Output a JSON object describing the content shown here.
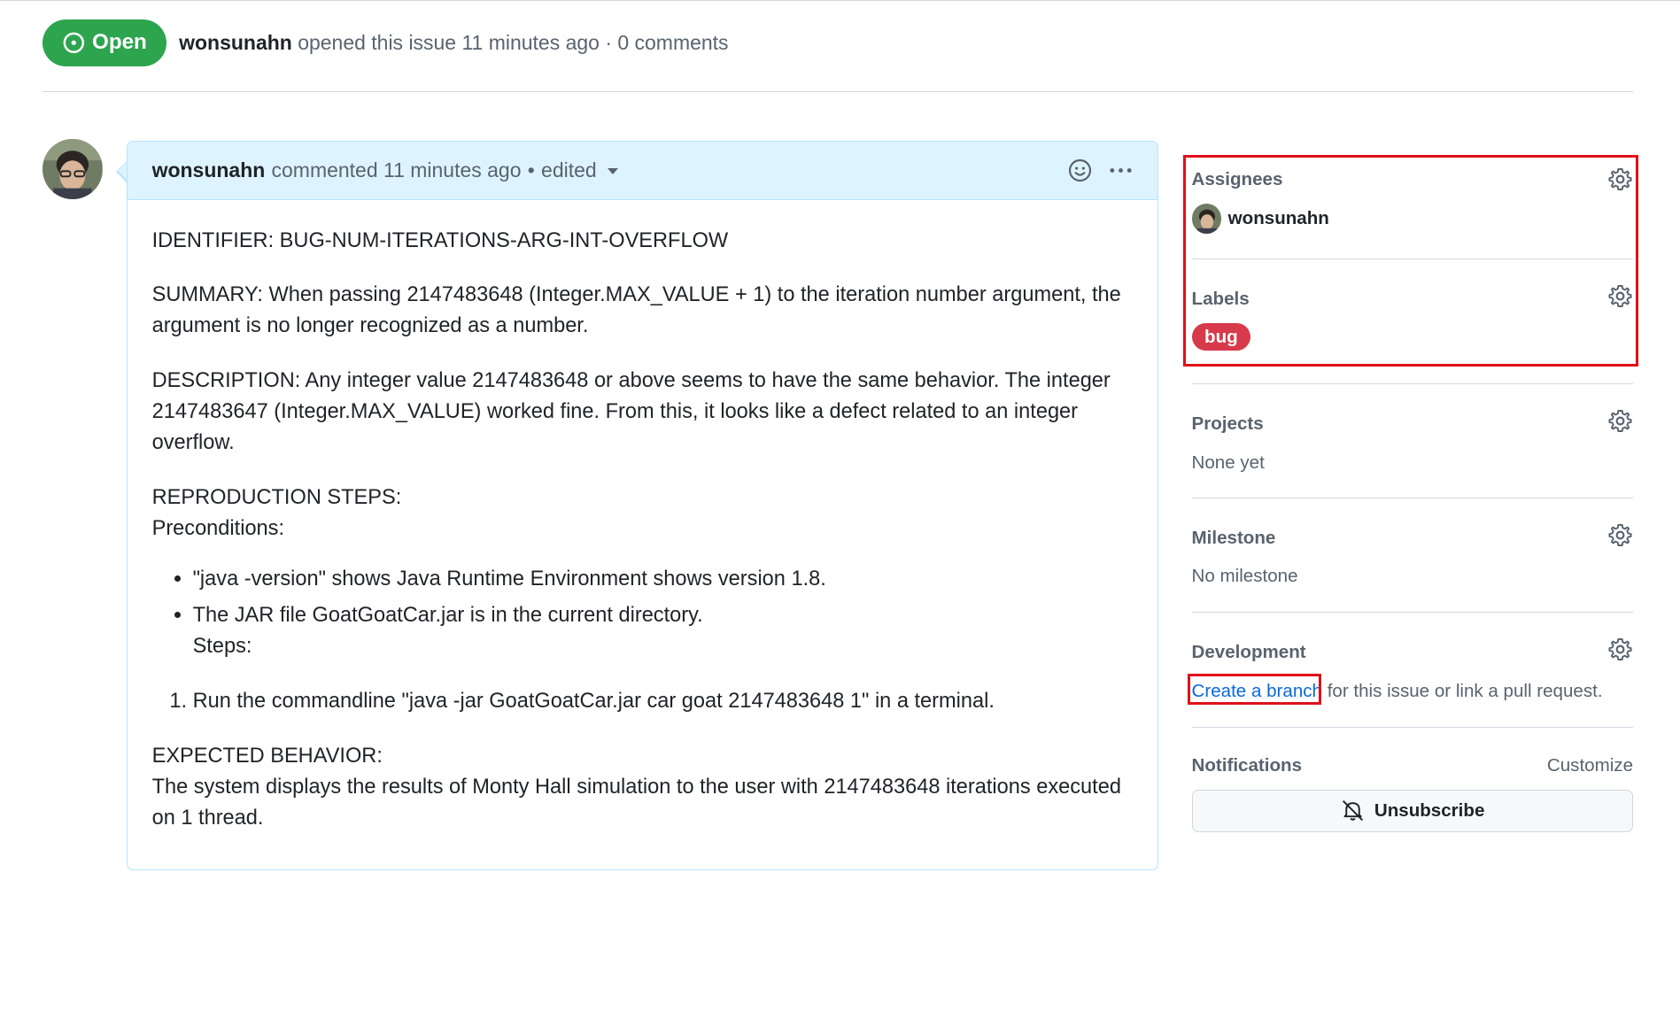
{
  "header": {
    "state": "Open",
    "author": "wonsunahn",
    "meta": "opened this issue 11 minutes ago · 0 comments"
  },
  "comment": {
    "author": "wonsunahn",
    "action": "commented",
    "time": "11 minutes ago",
    "separator": "•",
    "edited": "edited",
    "identifier": "IDENTIFIER: BUG-NUM-ITERATIONS-ARG-INT-OVERFLOW",
    "summary": "SUMMARY: When passing 2147483648 (Integer.MAX_VALUE + 1) to the iteration number argument, the argument is no longer recognized as a number.",
    "description": "DESCRIPTION: Any integer value 2147483648 or above seems to have the same behavior. The integer 2147483647 (Integer.MAX_VALUE) worked fine. From this, it looks like a defect related to an integer overflow.",
    "repro_heading": "REPRODUCTION STEPS:",
    "preconditions_heading": "Preconditions:",
    "preconditions": [
      "\"java -version\" shows Java Runtime Environment shows version 1.8.",
      "The JAR file GoatGoatCar.jar is in the current directory."
    ],
    "steps_heading": "Steps:",
    "steps": [
      "Run the commandline \"java -jar GoatGoatCar.jar car goat 2147483648 1\" in a terminal."
    ],
    "expected_heading": "EXPECTED BEHAVIOR:",
    "expected": "The system displays the results of Monty Hall simulation to the user with 2147483648 iterations executed on 1 thread."
  },
  "sidebar": {
    "assignees": {
      "title": "Assignees",
      "user": "wonsunahn"
    },
    "labels": {
      "title": "Labels",
      "items": [
        "bug"
      ]
    },
    "projects": {
      "title": "Projects",
      "value": "None yet"
    },
    "milestone": {
      "title": "Milestone",
      "value": "No milestone"
    },
    "development": {
      "title": "Development",
      "link": "Create a branch",
      "suffix": "for this issue or link a pull request."
    },
    "notifications": {
      "title": "Notifications",
      "customize": "Customize",
      "button": "Unsubscribe"
    }
  },
  "colors": {
    "open_green": "#2da44e",
    "label_bug": "#d73a4a",
    "link_blue": "#0969da",
    "highlight_red": "#e0101a",
    "comment_header_bg": "#ddf4ff"
  },
  "icons": [
    "issue-opened-icon",
    "smiley-icon",
    "kebab-horizontal-icon",
    "gear-icon",
    "bell-slash-icon",
    "triangle-down-icon"
  ]
}
